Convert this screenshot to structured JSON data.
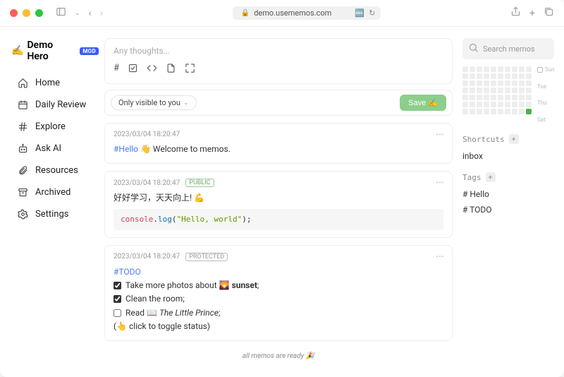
{
  "browser": {
    "url": "demo.usememos.com"
  },
  "brand": {
    "emoji": "✍️",
    "name": "Demo Hero",
    "badge": "MOD"
  },
  "nav": [
    {
      "icon": "home",
      "label": "Home"
    },
    {
      "icon": "calendar",
      "label": "Daily Review"
    },
    {
      "icon": "hash",
      "label": "Explore"
    },
    {
      "icon": "bot",
      "label": "Ask AI"
    },
    {
      "icon": "clip",
      "label": "Resources"
    },
    {
      "icon": "archive",
      "label": "Archived"
    },
    {
      "icon": "gear",
      "label": "Settings"
    }
  ],
  "composer": {
    "placeholder": "Any thoughts...",
    "visibility": "Only visible to you",
    "save": "Save ✍️"
  },
  "memos": [
    {
      "time": "2023/03/04 18:20:47",
      "badge": null,
      "tag": "#Hello",
      "body": " 👋 Welcome to memos."
    },
    {
      "time": "2023/03/04 18:20:47",
      "badge": "PUBLIC",
      "body": "好好学习，天天向上! 💪",
      "code": {
        "a": "console",
        "b": ".",
        "c": "log",
        "d": "(",
        "e": "\"Hello, world\"",
        "f": ");"
      }
    },
    {
      "time": "2023/03/04 18:20:47",
      "badge": "PROTECTED",
      "tag": "#TODO",
      "tasks": [
        {
          "done": true,
          "text": "Take more photos about 🌄 ",
          "bold": "sunset",
          "suffix": ";"
        },
        {
          "done": true,
          "text": "Clean the room;"
        },
        {
          "done": false,
          "text": "Read 📖 ",
          "italic": "The Little Prince",
          "suffix": ";"
        }
      ],
      "note": "(👆 click to toggle status)"
    }
  ],
  "footer": "all memos are ready 🎉",
  "rside": {
    "search": "Search memos",
    "days": [
      "Sun",
      "Tue",
      "Thu",
      "Sat"
    ],
    "shortcuts": {
      "title": "Shortcuts",
      "items": [
        "inbox"
      ]
    },
    "tags": {
      "title": "Tags",
      "items": [
        "# Hello",
        "# TODO"
      ]
    }
  }
}
